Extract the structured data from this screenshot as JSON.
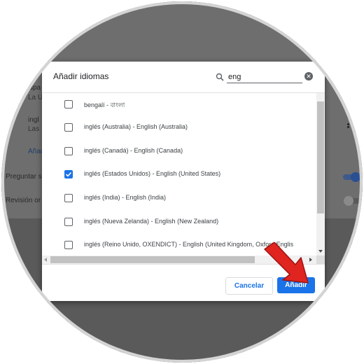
{
  "background": {
    "texts": {
      "spa": "spa",
      "la_u": "La U",
      "ingl": "ingl",
      "las": "Las",
      "anad": "Añad",
      "preguntar": "Preguntar s",
      "revision": "Revisión or"
    },
    "toggles": [
      {
        "name": "preguntar-toggle",
        "state": "on"
      },
      {
        "name": "revision-toggle",
        "state": "off"
      }
    ]
  },
  "dialog": {
    "title": "Añadir idiomas",
    "search": {
      "value": "eng",
      "icon": "search-icon",
      "clear_icon": "clear-icon",
      "clear_glyph": "✕"
    },
    "languages": [
      {
        "label": "bengalí - বাংলা",
        "checked": false
      },
      {
        "label": "inglés (Australia) - English (Australia)",
        "checked": false
      },
      {
        "label": "inglés (Canadá) - English (Canada)",
        "checked": false
      },
      {
        "label": "inglés (Estados Unidos) - English (United States)",
        "checked": true
      },
      {
        "label": "inglés (India) - English (India)",
        "checked": false
      },
      {
        "label": "inglés (Nueva Zelanda) - English (New Zealand)",
        "checked": false
      },
      {
        "label": "inglés (Reino Unido, OXENDICT) - English (United Kingdom, Oxford Englis",
        "checked": false
      }
    ],
    "buttons": {
      "cancel": "Cancelar",
      "add": "Añadir"
    }
  },
  "colors": {
    "accent": "#1a73e8",
    "arrow": "#e0241f",
    "overlay": "#5b5b5b"
  }
}
